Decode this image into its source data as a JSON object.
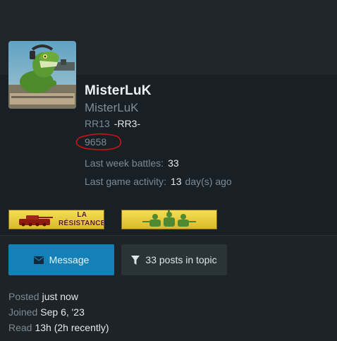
{
  "profile": {
    "username": "MisterLuK",
    "user_title": "MisterLuK",
    "clan_id": "RR13",
    "clan_tag": "-RR3-",
    "rating": "9658",
    "last_week_battles_label": "Last week battles",
    "last_week_battles_value": "33",
    "last_activity_label": "Last game activity",
    "last_activity_value": "13",
    "last_activity_suffix": "day(s) ago"
  },
  "badges": {
    "resistance_line1": "LA",
    "resistance_line2": "RÉSISTANCE"
  },
  "buttons": {
    "message_label": "Message",
    "posts_label": "33 posts in topic"
  },
  "meta": {
    "posted_label": "Posted",
    "posted_value": "just now",
    "joined_label": "Joined",
    "joined_value": "Sep 6, '23",
    "read_label": "Read",
    "read_value": "13h (2h recently)"
  },
  "colors": {
    "accent_button": "#1380b8",
    "badge_gold": "#e8cc3a",
    "annotation_red": "#c81414"
  },
  "icons": {
    "avatar": "lizard-soldier-avatar",
    "message": "envelope-icon",
    "posts": "filter-funnel-icon"
  }
}
